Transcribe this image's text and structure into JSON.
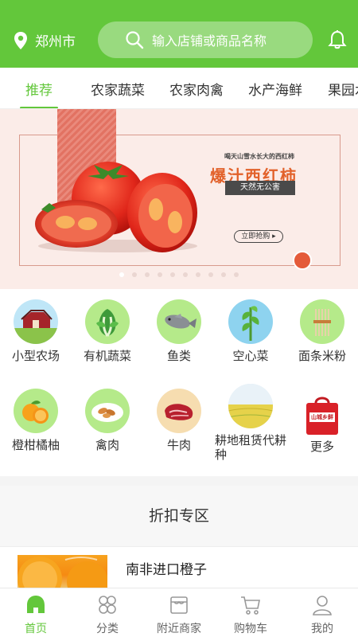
{
  "header": {
    "location": "郑州市",
    "search_placeholder": "输入店铺或商品名称"
  },
  "tabs": [
    {
      "label": "推荐",
      "active": true
    },
    {
      "label": "农家蔬菜"
    },
    {
      "label": "农家肉禽"
    },
    {
      "label": "水产海鲜"
    },
    {
      "label": "果园水"
    }
  ],
  "banner": {
    "small_title": "喝天山雪水长大的西红柿",
    "title": "爆汁西红柿",
    "tag": "天然无公害",
    "button": "立即抢购 ▸"
  },
  "categories_row1": [
    {
      "label": "小型农场",
      "icon": "farm-icon"
    },
    {
      "label": "有机蔬菜",
      "icon": "vegetable-icon"
    },
    {
      "label": "鱼类",
      "icon": "fish-icon"
    },
    {
      "label": "空心菜",
      "icon": "water-spinach-icon"
    },
    {
      "label": "面条米粉",
      "icon": "noodle-icon"
    }
  ],
  "categories_row2": [
    {
      "label": "橙柑橘柚",
      "icon": "orange-icon"
    },
    {
      "label": "禽肉",
      "icon": "poultry-icon"
    },
    {
      "label": "牛肉",
      "icon": "beef-icon"
    },
    {
      "label": "耕地租赁代耕种",
      "icon": "field-icon"
    },
    {
      "label": "更多",
      "icon": "more-bag-icon",
      "bag_text": "山城乡鲜"
    }
  ],
  "discount": {
    "title": "折扣专区",
    "product_name": "南非进口橙子"
  },
  "bottom_nav": [
    {
      "label": "首页",
      "active": true
    },
    {
      "label": "分类"
    },
    {
      "label": "附近商家"
    },
    {
      "label": "购物车"
    },
    {
      "label": "我的"
    }
  ],
  "colors": {
    "brand_green": "#63c73b",
    "banner_bg": "#fbece8"
  }
}
